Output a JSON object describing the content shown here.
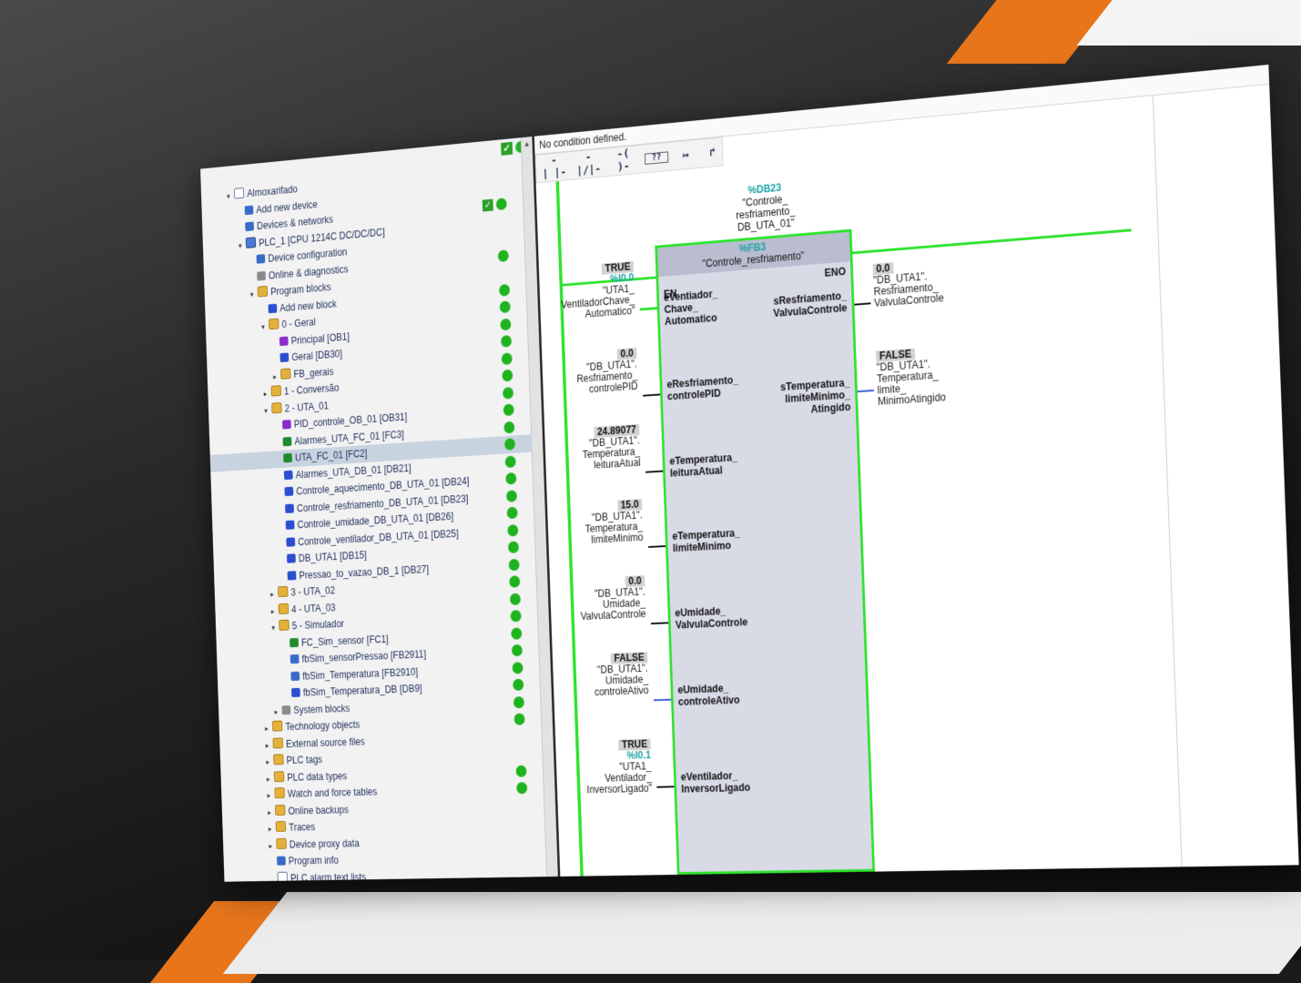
{
  "tree": {
    "project": "Almoxarifado",
    "items": [
      {
        "label": "Almoxarifado",
        "depth": 0,
        "chev": "▾",
        "icon": "project-icon",
        "status": ""
      },
      {
        "label": "Add new device",
        "depth": 1,
        "chev": "",
        "icon": "add-device-icon",
        "status": ""
      },
      {
        "label": "Devices & networks",
        "depth": 1,
        "chev": "",
        "icon": "network-icon",
        "status": "check"
      },
      {
        "label": "PLC_1 [CPU 1214C DC/DC/DC]",
        "depth": 1,
        "chev": "▾",
        "icon": "plc-icon",
        "status": ""
      },
      {
        "label": "Device configuration",
        "depth": 2,
        "chev": "",
        "icon": "device-config-icon",
        "status": ""
      },
      {
        "label": "Online & diagnostics",
        "depth": 2,
        "chev": "",
        "icon": "diagnostics-icon",
        "status": "dot"
      },
      {
        "label": "Program blocks",
        "depth": 2,
        "chev": "▾",
        "icon": "folder-icon",
        "status": ""
      },
      {
        "label": "Add new block",
        "depth": 3,
        "chev": "",
        "icon": "add-block-icon",
        "status": "dot"
      },
      {
        "label": "0 - Geral",
        "depth": 3,
        "chev": "▾",
        "icon": "folder-icon",
        "status": "dot"
      },
      {
        "label": "Principal [OB1]",
        "depth": 4,
        "chev": "",
        "icon": "ob-icon",
        "status": "dot"
      },
      {
        "label": "Geral [DB30]",
        "depth": 4,
        "chev": "",
        "icon": "db-icon",
        "status": "dot"
      },
      {
        "label": "FB_gerais",
        "depth": 4,
        "chev": "▸",
        "icon": "folder-icon",
        "status": "dot"
      },
      {
        "label": "1 - Conversão",
        "depth": 3,
        "chev": "▸",
        "icon": "folder-icon",
        "status": "dot"
      },
      {
        "label": "2 - UTA_01",
        "depth": 3,
        "chev": "▾",
        "icon": "folder-icon",
        "status": "dot"
      },
      {
        "label": "PID_controle_OB_01 [OB31]",
        "depth": 4,
        "chev": "",
        "icon": "ob-icon",
        "status": "dot"
      },
      {
        "label": "Alarmes_UTA_FC_01 [FC3]",
        "depth": 4,
        "chev": "",
        "icon": "fc-icon",
        "status": "dot"
      },
      {
        "label": "UTA_FC_01 [FC2]",
        "depth": 4,
        "chev": "",
        "icon": "fc-icon",
        "status": "dot",
        "selected": true
      },
      {
        "label": "Alarmes_UTA_DB_01 [DB21]",
        "depth": 4,
        "chev": "",
        "icon": "db-icon",
        "status": "dot"
      },
      {
        "label": "Controle_aquecimento_DB_UTA_01 [DB24]",
        "depth": 4,
        "chev": "",
        "icon": "db-icon",
        "status": "dot"
      },
      {
        "label": "Controle_resfriamento_DB_UTA_01 [DB23]",
        "depth": 4,
        "chev": "",
        "icon": "db-icon",
        "status": "dot"
      },
      {
        "label": "Controle_umidade_DB_UTA_01 [DB26]",
        "depth": 4,
        "chev": "",
        "icon": "db-icon",
        "status": "dot"
      },
      {
        "label": "Controle_ventilador_DB_UTA_01 [DB25]",
        "depth": 4,
        "chev": "",
        "icon": "db-icon",
        "status": "dot"
      },
      {
        "label": "DB_UTA1 [DB15]",
        "depth": 4,
        "chev": "",
        "icon": "db-icon",
        "status": "dot"
      },
      {
        "label": "Pressao_to_vazao_DB_1 [DB27]",
        "depth": 4,
        "chev": "",
        "icon": "db-icon",
        "status": "dot"
      },
      {
        "label": "3 - UTA_02",
        "depth": 3,
        "chev": "▸",
        "icon": "folder-icon",
        "status": "dot"
      },
      {
        "label": "4 - UTA_03",
        "depth": 3,
        "chev": "▸",
        "icon": "folder-icon",
        "status": "dot"
      },
      {
        "label": "5 - Simulador",
        "depth": 3,
        "chev": "▾",
        "icon": "folder-icon",
        "status": "dot"
      },
      {
        "label": "FC_Sim_sensor [FC1]",
        "depth": 4,
        "chev": "",
        "icon": "fc-icon",
        "status": "dot"
      },
      {
        "label": "fbSim_sensorPressao [FB2911]",
        "depth": 4,
        "chev": "",
        "icon": "fb-icon",
        "status": "dot"
      },
      {
        "label": "fbSim_Temperatura [FB2910]",
        "depth": 4,
        "chev": "",
        "icon": "fb-icon",
        "status": "dot"
      },
      {
        "label": "fbSim_Temperatura_DB [DB9]",
        "depth": 4,
        "chev": "",
        "icon": "db-icon",
        "status": "dot"
      },
      {
        "label": "System blocks",
        "depth": 3,
        "chev": "▸",
        "icon": "folder-gray-icon",
        "status": "dot"
      },
      {
        "label": "Technology objects",
        "depth": 2,
        "chev": "▸",
        "icon": "folder-icon",
        "status": "dot"
      },
      {
        "label": "External source files",
        "depth": 2,
        "chev": "▸",
        "icon": "folder-icon",
        "status": ""
      },
      {
        "label": "PLC tags",
        "depth": 2,
        "chev": "▸",
        "icon": "folder-icon",
        "status": ""
      },
      {
        "label": "PLC data types",
        "depth": 2,
        "chev": "▸",
        "icon": "folder-icon",
        "status": "dot"
      },
      {
        "label": "Watch and force tables",
        "depth": 2,
        "chev": "▸",
        "icon": "folder-icon",
        "status": "dot"
      },
      {
        "label": "Online backups",
        "depth": 2,
        "chev": "▸",
        "icon": "folder-icon",
        "status": ""
      },
      {
        "label": "Traces",
        "depth": 2,
        "chev": "▸",
        "icon": "folder-icon",
        "status": ""
      },
      {
        "label": "Device proxy data",
        "depth": 2,
        "chev": "▸",
        "icon": "folder-icon",
        "status": ""
      },
      {
        "label": "Program info",
        "depth": 2,
        "chev": "",
        "icon": "program-info-icon",
        "status": ""
      },
      {
        "label": "PLC alarm text lists",
        "depth": 2,
        "chev": "",
        "icon": "alarm-list-icon",
        "status": ""
      }
    ]
  },
  "editor": {
    "condition": "No condition defined.",
    "toolbar": [
      "-| |-",
      "-|/|-",
      "-( )-",
      "??",
      "↦",
      "↱"
    ],
    "instance": {
      "address": "%DB23",
      "name": "\"Controle_\nresfriamento_\nDB_UTA_01\""
    },
    "block": {
      "number": "%FB3",
      "name": "\"Controle_resfriamento\"",
      "en": "EN",
      "eno": "ENO"
    },
    "inputs": [
      {
        "pin": "eVentiador_\nChave_\nAutomatico",
        "value": "TRUE",
        "address": "%I0.0",
        "var": "\"UTA1_\nVentiladorChave_\nAutomatico\"",
        "wire": "green"
      },
      {
        "pin": "eResfriamento_\ncontrolePID",
        "value": "0.0",
        "address": "",
        "var": "\"DB_UTA1\".\nResfriamento_\ncontrolePID",
        "wire": "black"
      },
      {
        "pin": "eTemperatura_\nleituraAtual",
        "value": "24.89077",
        "address": "",
        "var": "\"DB_UTA1\".\nTemperatura_\nleituraAtual",
        "wire": "black"
      },
      {
        "pin": "eTemperatura_\nlimiteMinimo",
        "value": "15.0",
        "address": "",
        "var": "\"DB_UTA1\".\nTemperatura_\nlimiteMinimo",
        "wire": "black"
      },
      {
        "pin": "eUmidade_\nValvulaControle",
        "value": "0.0",
        "address": "",
        "var": "\"DB_UTA1\".\nUmidade_\nValvulaControle",
        "wire": "black"
      },
      {
        "pin": "eUmidade_\ncontroleAtivo",
        "value": "FALSE",
        "address": "",
        "var": "\"DB_UTA1\".\nUmidade_\ncontroleAtivo",
        "wire": "blue"
      },
      {
        "pin": "eVentilador_\nInversorLigado",
        "value": "TRUE",
        "address": "%I0.1",
        "var": "\"UTA1_\nVentilador_\nInversorLigado\"",
        "wire": "black"
      }
    ],
    "outputs": [
      {
        "pin": "sResfriamento_\nValvulaControle",
        "value": "0.0",
        "var": "\"DB_UTA1\".\nResfriamento_\nValvulaControle",
        "wire": "black"
      },
      {
        "pin": "sTemperatura_\nlimiteMinimo_\nAtingido",
        "value": "FALSE",
        "var": "\"DB_UTA1\".\nTemperatura_\nlimite_\nMinimoAtingido",
        "wire": "blue"
      }
    ]
  },
  "colors": {
    "wire_green": "#2ee32e",
    "address_teal": "#1fa3a8",
    "block_fill": "#d8dae6",
    "orange_accent": "#e8751a"
  }
}
